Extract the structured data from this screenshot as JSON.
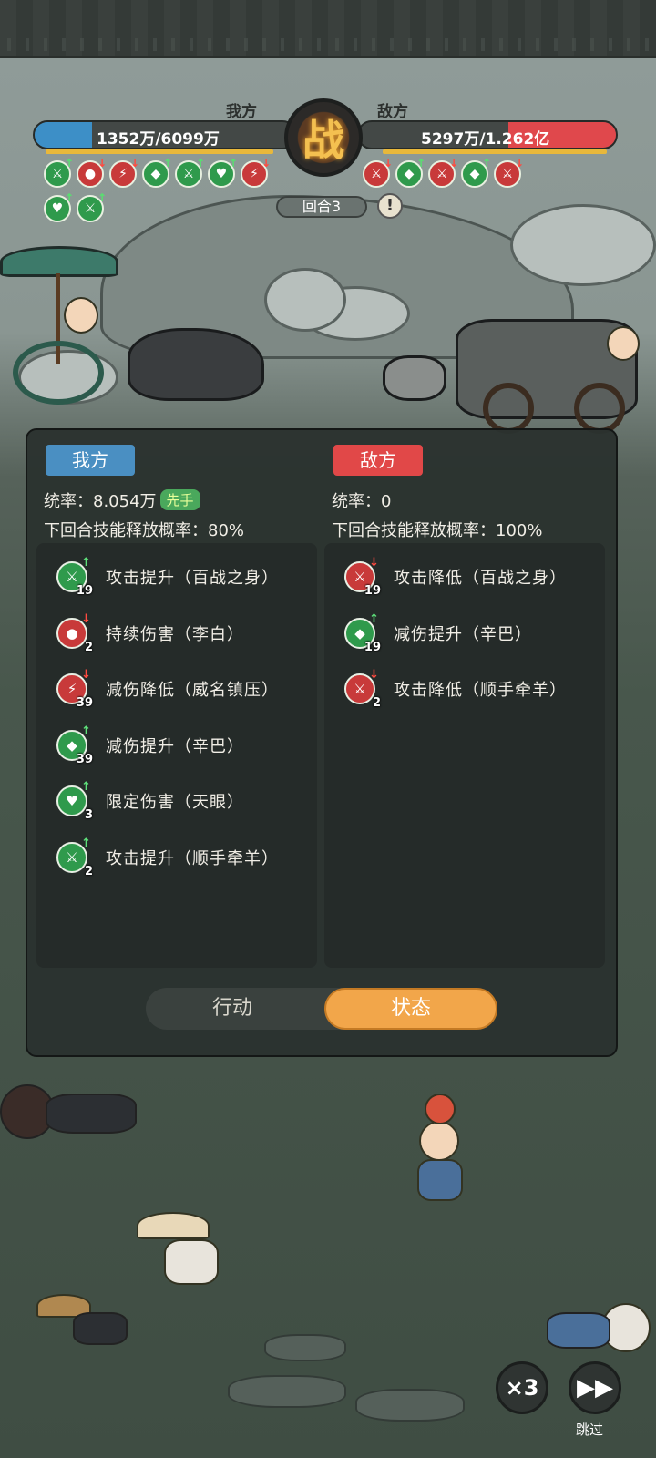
{
  "header": {
    "ally_label": "我方",
    "enemy_label": "敌方",
    "ally_hp_text": "1352万/6099万",
    "enemy_hp_text": "5297万/1.262亿",
    "ally_hp_ratio": 0.22,
    "enemy_hp_ratio": 0.42,
    "emblem": "战",
    "round": "回合3",
    "hint": "!"
  },
  "panel": {
    "ally": {
      "tag": "我方",
      "command": "统率：8.054万",
      "first_badge": "先手",
      "skill_rate": "下回合技能释放概率：80%",
      "effects": [
        {
          "label": "攻击提升（百战之身）",
          "count": "19",
          "icon": "sword-icon",
          "color": "green",
          "arrow": "↑"
        },
        {
          "label": "持续伤害（李白）",
          "count": "2",
          "icon": "blood-drop-icon",
          "color": "red",
          "arrow": "↓"
        },
        {
          "label": "减伤降低（威名镇压）",
          "count": "39",
          "icon": "broken-shield-icon",
          "color": "red",
          "arrow": "↓"
        },
        {
          "label": "减伤提升（辛巴）",
          "count": "39",
          "icon": "shield-icon",
          "color": "green",
          "arrow": "↑"
        },
        {
          "label": "限定伤害（天眼）",
          "count": "3",
          "icon": "heart-shield-icon",
          "color": "green",
          "arrow": "↑"
        },
        {
          "label": "攻击提升（顺手牵羊）",
          "count": "2",
          "icon": "sword-icon",
          "color": "green",
          "arrow": "↑"
        }
      ]
    },
    "enemy": {
      "tag": "敌方",
      "command": "统率：0",
      "skill_rate": "下回合技能释放概率：100%",
      "effects": [
        {
          "label": "攻击降低（百战之身）",
          "count": "19",
          "icon": "sword-icon",
          "color": "red",
          "arrow": "↓"
        },
        {
          "label": "减伤提升（辛巴）",
          "count": "19",
          "icon": "shield-icon",
          "color": "green",
          "arrow": "↑"
        },
        {
          "label": "攻击降低（顺手牵羊）",
          "count": "2",
          "icon": "sword-icon",
          "color": "red",
          "arrow": "↓"
        }
      ]
    },
    "tabs": {
      "action": "行动",
      "status": "状态"
    }
  },
  "controls": {
    "speed": "×3",
    "skip_label": "跳过"
  },
  "colors": {
    "ally_blue": "#4a8fc2",
    "enemy_red": "#e14848",
    "buff_green": "#2f9a4c",
    "debuff_red": "#c83a3a",
    "active_tab": "#f2a64a"
  }
}
